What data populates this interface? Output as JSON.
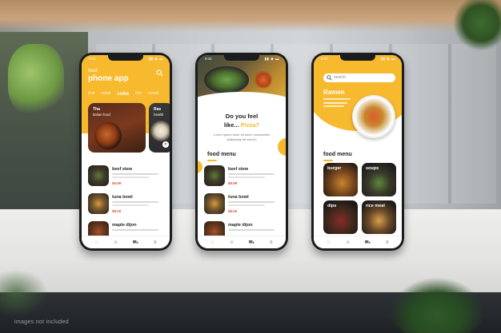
{
  "watermark": "images not included",
  "phone1": {
    "status_time": "9:41",
    "status_icons": "▮▮ ◆ ▬",
    "food_label": "food",
    "title": "phone app",
    "categories": [
      {
        "label": "fruit",
        "active": false
      },
      {
        "label": "salad",
        "active": false
      },
      {
        "label": "coks",
        "active": true
      },
      {
        "label": "fish",
        "active": false
      },
      {
        "label": "cereal",
        "active": false
      }
    ],
    "featured": [
      {
        "line1": "Tha",
        "line2": "italian food"
      },
      {
        "line1": "Ras",
        "line2": "health"
      }
    ],
    "menu": [
      {
        "name": "beef stew",
        "price": "$5.99"
      },
      {
        "name": "tuna bowl",
        "price": "$8.00"
      },
      {
        "name": "maple dijon",
        "price": "$8.00"
      }
    ]
  },
  "phone2": {
    "status_time": "9:41",
    "status_icons": "▮▮ ◆ ▬",
    "question_line1": "Do you feel",
    "question_line2_prefix": "like...",
    "question_highlight": "Pizza?",
    "paragraph": "Lorem ipsum dolor sit amet, consectetur adipiscing elit sed do",
    "section_title": "food menu",
    "menu": [
      {
        "name": "beef stew",
        "price": "$5.99"
      },
      {
        "name": "tuna bowl",
        "price": "$8.00"
      },
      {
        "name": "maple dijon",
        "price": "$8.00"
      }
    ]
  },
  "phone3": {
    "status_time": "9:41",
    "status_icons": "▮▮ ◆ ▬",
    "search_placeholder": "search",
    "featured_title": "Ramen",
    "section_title": "food menu",
    "tiles": [
      {
        "label": "burger"
      },
      {
        "label": "soups"
      },
      {
        "label": "dips"
      },
      {
        "label": "rice meal"
      }
    ]
  },
  "tabbar": {
    "icons": [
      "home-icon",
      "profile-icon",
      "cart-icon",
      "menu-icon"
    ],
    "glyphs": [
      "⌂",
      "☺",
      "⛟",
      "≡"
    ]
  },
  "colors": {
    "accent": "#f7b92e",
    "price": "#e0513c"
  }
}
